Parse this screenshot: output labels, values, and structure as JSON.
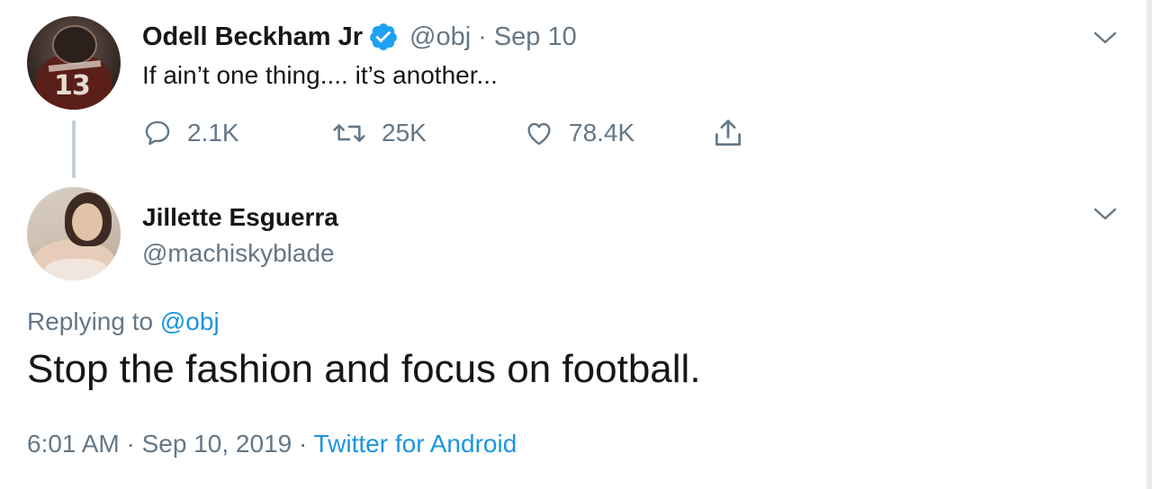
{
  "parent_tweet": {
    "author_name": "Odell Beckham Jr",
    "verified": true,
    "handle": "@obj",
    "separator": "·",
    "date": "Sep 10",
    "text": "If ain’t one thing.... it’s another...",
    "replies": "2.1K",
    "retweets": "25K",
    "likes": "78.4K",
    "avatar_jersey_number": "13"
  },
  "reply_tweet": {
    "author_name": "Jillette Esguerra",
    "handle": "@machiskyblade",
    "replying_to_label": "Replying to",
    "replying_to_handle": "@obj",
    "text": "Stop the fashion and focus on football.",
    "time": "6:01 AM",
    "separator": "·",
    "date": "Sep 10, 2019",
    "separator2": "·",
    "source": "Twitter for Android"
  },
  "colors": {
    "text_primary": "#14171a",
    "text_secondary": "#657786",
    "link": "#1b95e0",
    "verified_badge": "#1da1f2",
    "thread_line": "#c4cfd6"
  },
  "icons": {
    "reply": "reply-icon",
    "retweet": "retweet-icon",
    "like": "heart-icon",
    "share": "share-icon",
    "more": "chevron-down-icon",
    "verified": "verified-badge-icon"
  }
}
